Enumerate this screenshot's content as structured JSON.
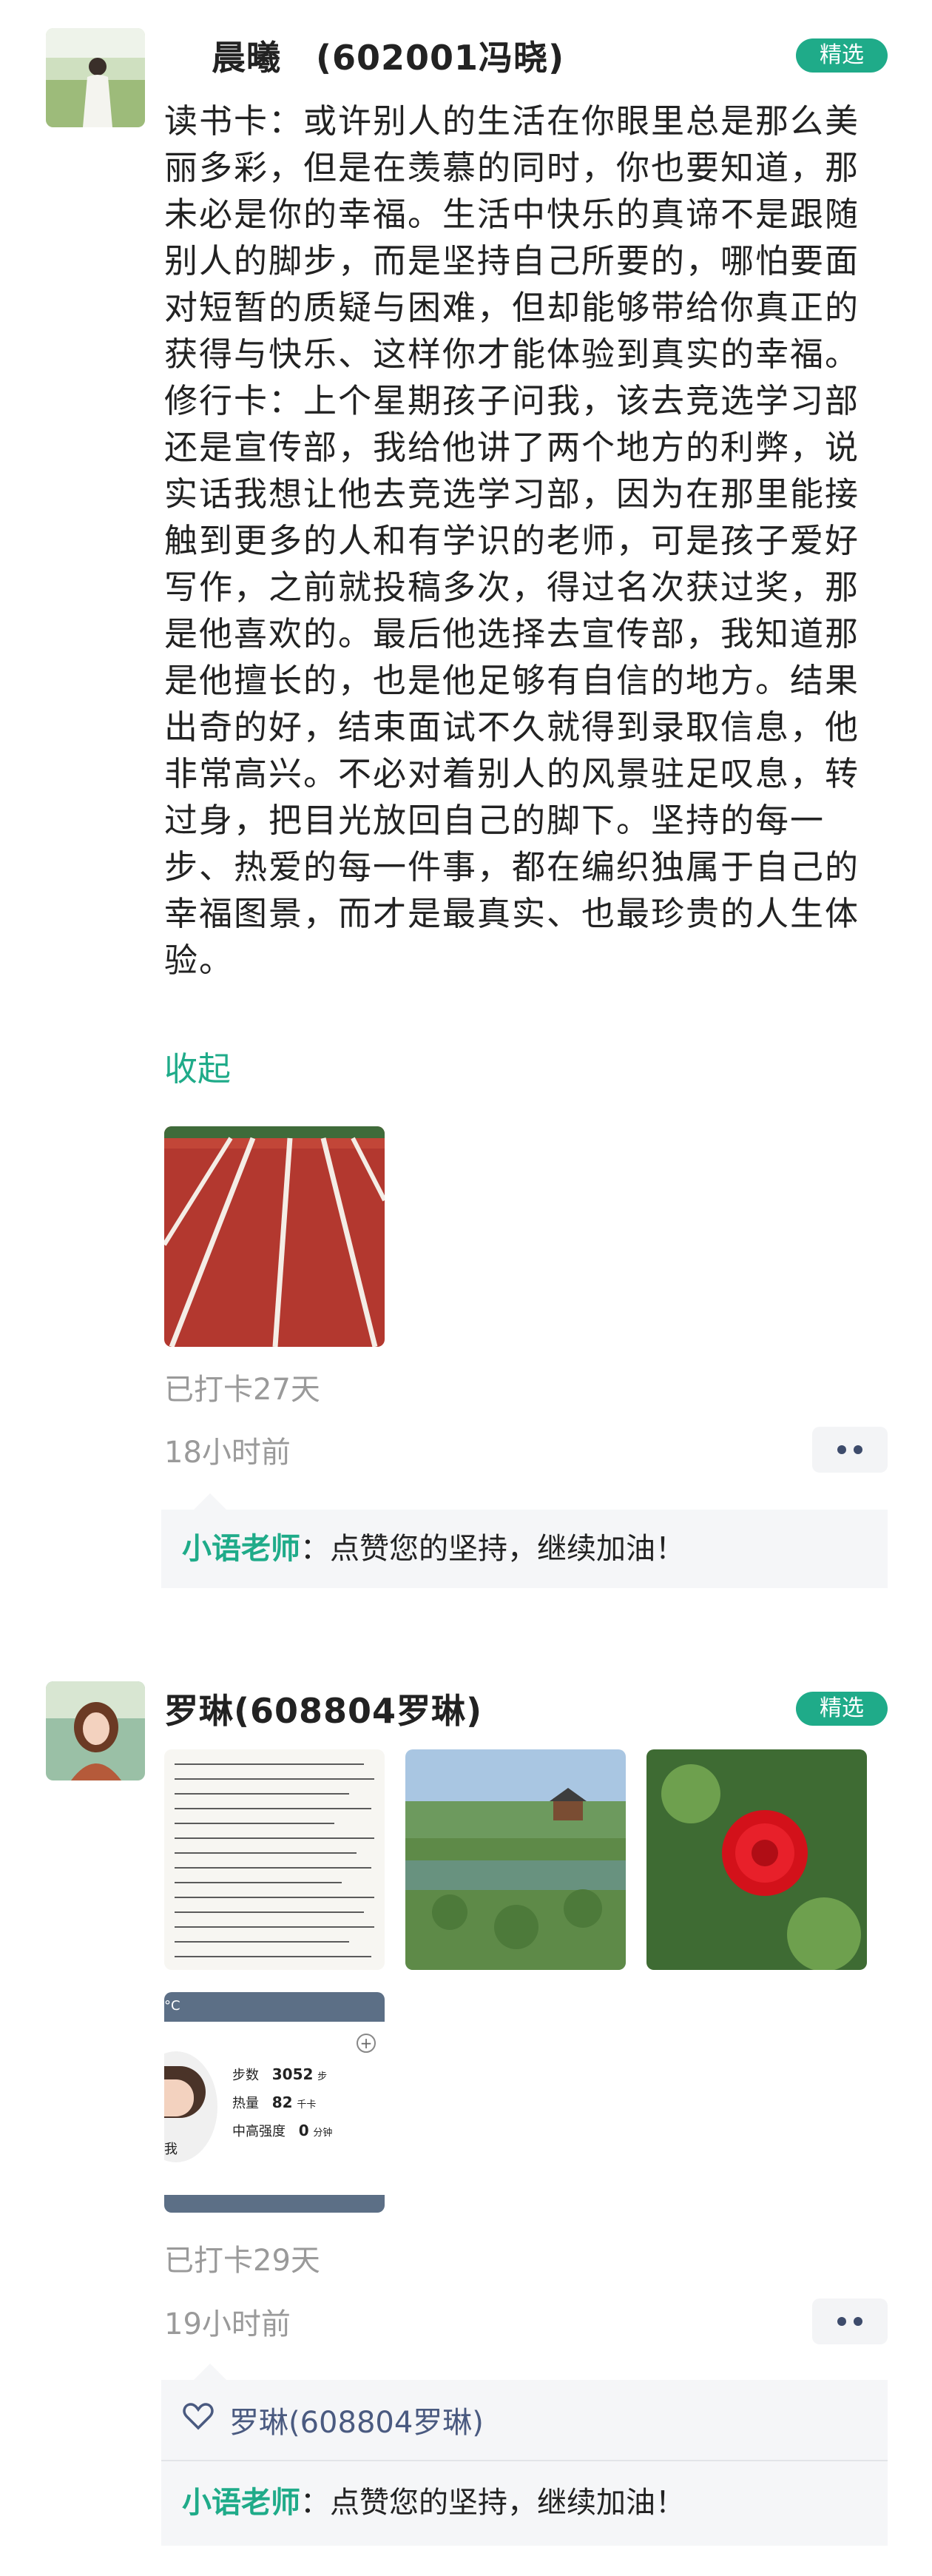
{
  "colors": {
    "accent": "#1fab89",
    "badge_bg": "#1fab89",
    "meta": "#9a9a9a",
    "comment_bg": "#f5f6f8",
    "like_name": "#4a5a80"
  },
  "posts": [
    {
      "author": "晨曦　(602001冯晓)",
      "badge": "精选",
      "text": "读书卡：或许别人的生活在你眼里总是那么美丽多彩，但是在羡慕的同时，你也要知道，那未必是你的幸福。生活中快乐的真谛不是跟随别人的脚步，而是坚持自己所要的，哪怕要面对短暂的质疑与困难，但却能够带给你真正的获得与快乐、这样你才能体验到真实的幸福。\n修行卡：上个星期孩子问我，该去竞选学习部还是宣传部，我给他讲了两个地方的利弊，说实话我想让他去竞选学习部，因为在那里能接触到更多的人和有学识的老师，可是孩子爱好写作，之前就投稿多次，得过名次获过奖，那是他喜欢的。最后他选择去宣传部，我知道那是他擅长的，也是他足够有自信的地方。结果出奇的好，结束面试不久就得到录取信息，他非常高兴。不必对着别人的风景驻足叹息，转过身，把目光放回自己的脚下。坚持的每一步、热爱的每一件事，都在编织独属于自己的幸福图景，而才是最真实、也最珍贵的人生体验。",
      "collapse": "收起",
      "checkin": "已打卡27天",
      "time": "18小时前",
      "comment_author": "小语老师",
      "comment_text": "：点赞您的坚持，继续加油！"
    },
    {
      "author": "罗琳(608804罗琳)",
      "badge": "精选",
      "checkin": "已打卡29天",
      "time": "19小时前",
      "like_name": "罗琳(608804罗琳)",
      "comment_author": "小语老师",
      "comment_text": "：点赞您的坚持，继续加油！",
      "fitness": {
        "unit": "°C",
        "steps_label": "步数",
        "steps": "3052",
        "steps_unit": "步",
        "cal_label": "热量",
        "cal": "82",
        "cal_unit": "千卡",
        "int_label": "中高强度",
        "int": "0",
        "int_unit": "分钟",
        "me": "我"
      }
    }
  ]
}
